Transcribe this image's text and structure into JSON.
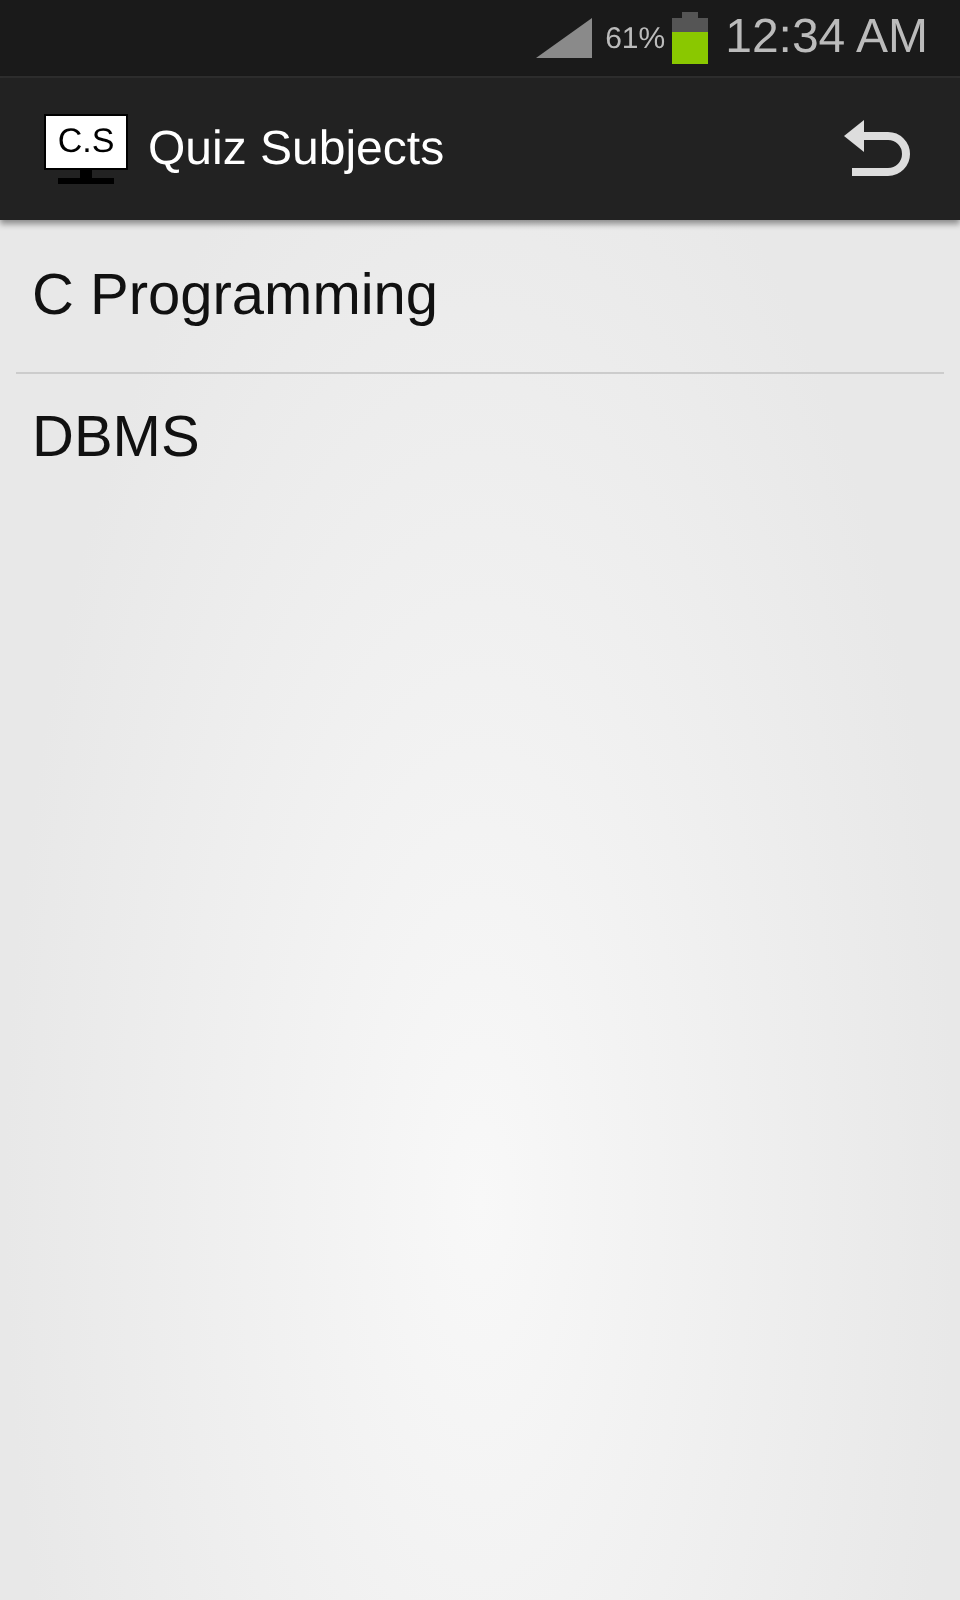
{
  "status_bar": {
    "battery_percent": "61%",
    "time": "12:34 AM"
  },
  "action_bar": {
    "logo_text": "C.S",
    "title": "Quiz Subjects"
  },
  "subjects": [
    {
      "label": "C Programming"
    },
    {
      "label": "DBMS"
    }
  ]
}
